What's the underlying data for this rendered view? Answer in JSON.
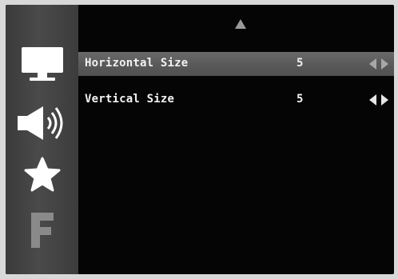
{
  "osd": {
    "categories": [
      {
        "icon": "monitor-icon",
        "selected": true
      },
      {
        "icon": "speaker-icon",
        "selected": false
      },
      {
        "icon": "star-icon",
        "selected": false
      },
      {
        "icon": "f-letter-icon",
        "selected": false
      }
    ],
    "items": [
      {
        "label": "Horizontal Size",
        "value": "5",
        "selected": true
      },
      {
        "label": "Vertical Size",
        "value": "5",
        "selected": false
      }
    ],
    "colors": {
      "screen_bg": "#050505",
      "sidebar_bg": "#444444",
      "highlight": "#5e5e5e",
      "text": "#f2f2f2"
    }
  }
}
